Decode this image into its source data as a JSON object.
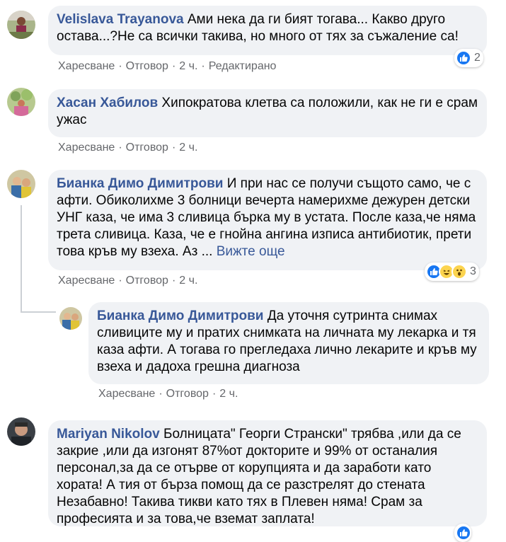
{
  "comments": [
    {
      "author": "Velislava Trayanova",
      "text": "Ами нека да ги бият тогава... Какво друго остава...?Не са всички такива, но много от тях за съжаление са!",
      "like": "Харесване",
      "reply": "Отговор",
      "time": "2 ч.",
      "edited": "Редактирано",
      "reaction_count": "2"
    },
    {
      "author": "Хасан Хабилов",
      "text": "Хипократова клетва са положили, как не ги е срам ужас",
      "like": "Харесване",
      "reply": "Отговор",
      "time": "2 ч."
    },
    {
      "author": "Бианка Димо Димитрови",
      "text": "И при нас се получи същото само, че с афти. Обиколихме 3 болници вечерта намерихме дежурен детски УНГ каза, че има 3 сливица бърка му в устата. После каза,че няма трета сливица. Каза, че е гнойна ангина изписа антибиотик, прети това кръв му взеха. Аз ...",
      "see_more": "Вижте още",
      "like": "Харесване",
      "reply": "Отговор",
      "time": "2 ч.",
      "reaction_count": "3"
    },
    {
      "author": "Бианка Димо Димитрови",
      "text": "Да уточня сутринта снимах сливиците му и пратих снимката на личната му лекарка и тя каза афти. А тогава го прегледаха лично лекарите и кръв му взеха и дадоха грешна диагноза",
      "like": "Харесване",
      "reply": "Отговор",
      "time": "2 ч."
    },
    {
      "author": "Mariyan Nikolov",
      "text": "Болницата\" Георги Странски\" трябва ,или да се закрие ,или да изгонят 87%от докторите и 99% от останалия персонал,за да се отърве от корупцията и да заработи като хората! А тия от бърза помощ да се разстрелят до стената Незабавно! Такива тикви като тях в Плевен няма! Срам за професията и за това,че вземат заплата!"
    }
  ],
  "separator": "·",
  "colors": {
    "link": "#385898",
    "bubble": "#f0f2f5",
    "meta": "#65676b",
    "like": "#1877f2"
  }
}
